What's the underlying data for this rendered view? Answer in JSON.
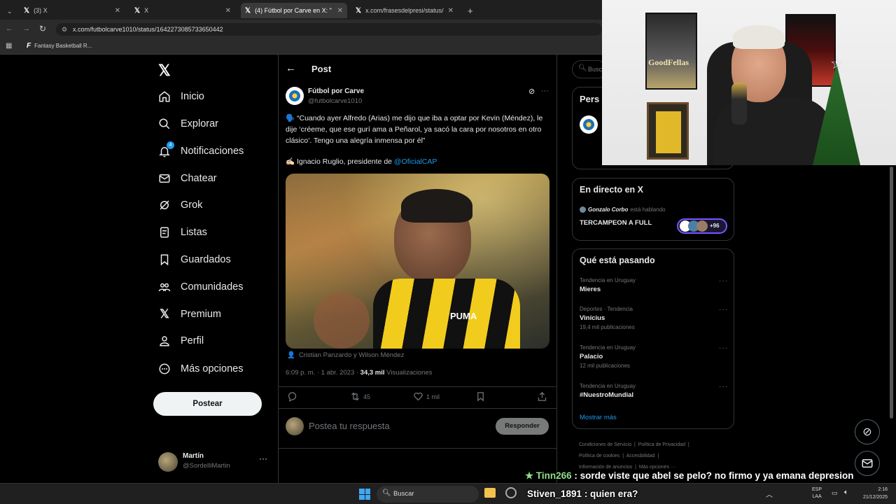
{
  "browser": {
    "tabs": [
      {
        "label": "(3) X"
      },
      {
        "label": "X"
      },
      {
        "label": "(4) Fútbol por Carve en X: \""
      },
      {
        "label": "x.com/frasesdelpresi/status/17…"
      }
    ],
    "url": "x.com/futbolcarve1010/status/1642273085733650442",
    "bookmark": "Fantasy Basketball R..."
  },
  "sidebar": {
    "items": [
      {
        "label": "Inicio",
        "icon": "home-icon"
      },
      {
        "label": "Explorar",
        "icon": "search-icon"
      },
      {
        "label": "Notificaciones",
        "icon": "bell-icon",
        "badge": "4"
      },
      {
        "label": "Chatear",
        "icon": "mail-icon"
      },
      {
        "label": "Grok",
        "icon": "grok-icon"
      },
      {
        "label": "Listas",
        "icon": "list-icon"
      },
      {
        "label": "Guardados",
        "icon": "bookmark-icon"
      },
      {
        "label": "Comunidades",
        "icon": "communities-icon"
      },
      {
        "label": "Premium",
        "icon": "x-logo-icon"
      },
      {
        "label": "Perfil",
        "icon": "profile-icon"
      },
      {
        "label": "Más opciones",
        "icon": "more-icon"
      }
    ],
    "post_button": "Postear",
    "account": {
      "name": "Martín",
      "handle": "@SordelliMartin"
    }
  },
  "post": {
    "header": "Post",
    "author_name": "Fútbol por Carve",
    "author_handle": "@futbolcarve1010",
    "text": "🗣️ “Cuando ayer Alfredo (Arias) me dijo que iba a optar por Kevin (Méndez), le dije ‘créeme, que ese gurí ama a Peñarol, ya sacó la cara por nosotros en otro clásico’. Tengo una alegría inmensa por él”",
    "attribution_prefix": "✍🏻 Ignacio Ruglio, presidente de ",
    "attribution_mention": "@OficialCAP",
    "image_caption": "Cristian Panzardo y Wilson Méndez",
    "timestamp": "6:09 p. m. · 1 abr. 2023 · ",
    "views_count": "34,3 mil",
    "views_label": " Visualizaciones",
    "retweets": "45",
    "likes": "1 mil",
    "reply_placeholder": "Postea tu respuesta",
    "reply_button": "Responder"
  },
  "right": {
    "search_placeholder": "Busc",
    "people_title": "Pers",
    "live_title": "En directo en X",
    "live_host": "Gonzalo Corbo",
    "live_status": " está hablando",
    "live_space": "TERCAMPEON A FULL",
    "live_count": "+96",
    "trends_title": "Qué está pasando",
    "trends": [
      {
        "label": "Tendencia en Uruguay",
        "name": "Mieres",
        "count": ""
      },
      {
        "label": "Deportes · Tendencia",
        "name": "Vinícius",
        "count": "19,4 mil publicaciones"
      },
      {
        "label": "Tendencia en Uruguay",
        "name": "Palacio",
        "count": "12 mil publicaciones"
      },
      {
        "label": "Tendencia en Uruguay",
        "name": "#NuestroMundial",
        "count": ""
      }
    ],
    "show_more": "Mostrar más",
    "footer": {
      "line1a": "Condiciones de Servicio",
      "line1b": "Política de Privacidad",
      "line2a": "Política de cookies",
      "line2b": "Accesibilidad",
      "line3a": "Información de anuncios",
      "line3b": "Más opciones ···"
    }
  },
  "chat": [
    {
      "user": "Tinn266",
      "message": " : sorde viste que abel se pelo? no firmo y ya emana depresion",
      "color": "#8ee08e"
    },
    {
      "user": "Stiven_1891",
      "message": " : quien era?",
      "color": "#ffffff"
    }
  ],
  "taskbar": {
    "search": "Buscar",
    "lang1": "ESP",
    "lang2": "LAA",
    "time": "2:16",
    "date": "21/12/2025"
  },
  "webcam": {
    "poster_left": "GoodFellas"
  }
}
